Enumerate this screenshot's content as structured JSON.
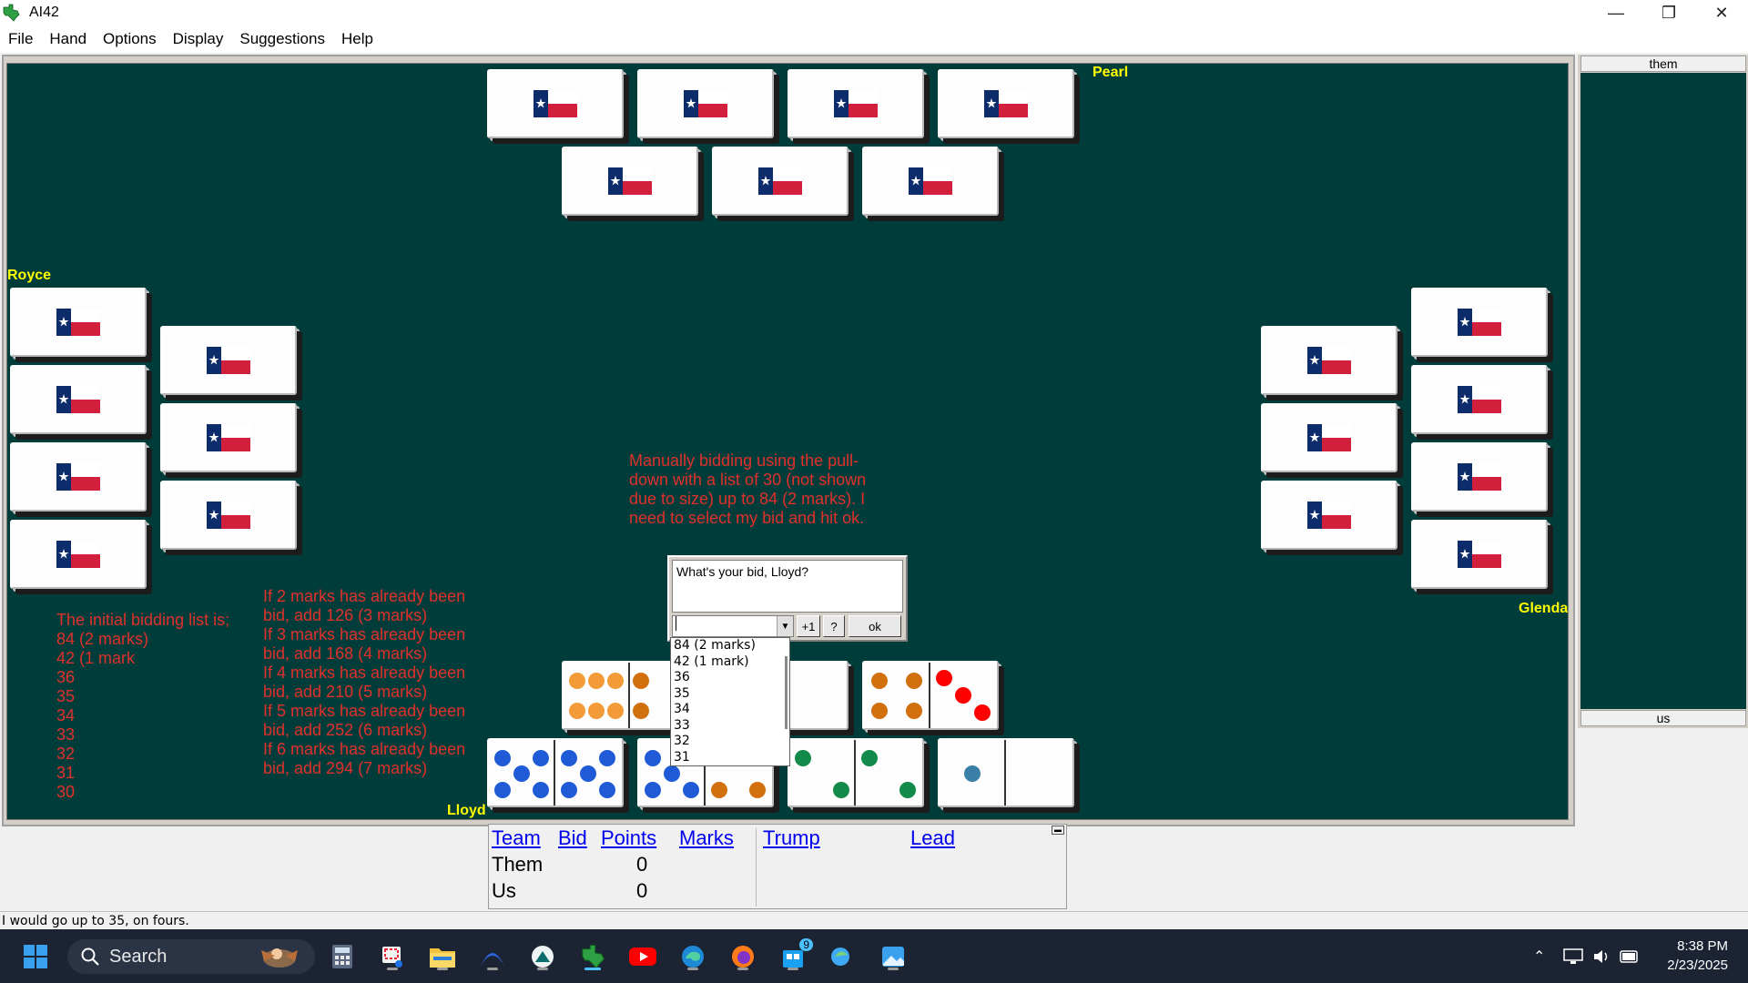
{
  "window": {
    "title": "AI42",
    "minimize": "—",
    "maximize": "❐",
    "close": "✕"
  },
  "menu": [
    "File",
    "Hand",
    "Options",
    "Display",
    "Suggestions",
    "Help"
  ],
  "players": {
    "north": "Pearl",
    "west": "Royce",
    "east": "Glenda",
    "south": "Lloyd"
  },
  "annotations": {
    "instruction": "Manually bidding using the pull-\ndown with a list of 30 (not shown\ndue to size) up to 84 (2 marks). I\nneed to select my bid and hit ok.",
    "initial_list": "The initial bidding list is;\n84 (2 marks)\n42 (1 mark\n36\n35\n34\n33\n32\n31\n30",
    "escalation": "If 2 marks has already been\nbid, add 126 (3 marks)\nIf 3 marks has already been\nbid, add 168 (4 marks)\nIf 4 marks has already been\nbid, add 210 (5 marks)\nIf 5 marks has already been\nbid, add 252 (6 marks)\nIf 6 marks has already been\nbid, add 294 (7 marks)"
  },
  "bid_dialog": {
    "prompt": "What's your bid, Lloyd?",
    "selected": "",
    "plus_one": "+1",
    "help": "?",
    "ok": "ok",
    "options": [
      "84 (2 marks)",
      "42 (1 mark)",
      "36",
      "35",
      "34",
      "33",
      "32",
      "31"
    ]
  },
  "score": {
    "headers": {
      "team": "Team",
      "bid": "Bid",
      "points": "Points",
      "marks": "Marks",
      "trump": "Trump",
      "lead": "Lead"
    },
    "rows": [
      {
        "team": "Them",
        "points": "0"
      },
      {
        "team": "Us",
        "points": "0"
      }
    ]
  },
  "side_panel": {
    "top_label": "them",
    "bottom_label": "us"
  },
  "status": "I would go up to 35, on fours.",
  "taskbar": {
    "search": "Search",
    "time": "8:38 PM",
    "date": "2/23/2025",
    "badge": "9"
  },
  "colors": {
    "felt": "#003c3a",
    "player_name": "#ffff00",
    "annotation": "#e0302c"
  }
}
